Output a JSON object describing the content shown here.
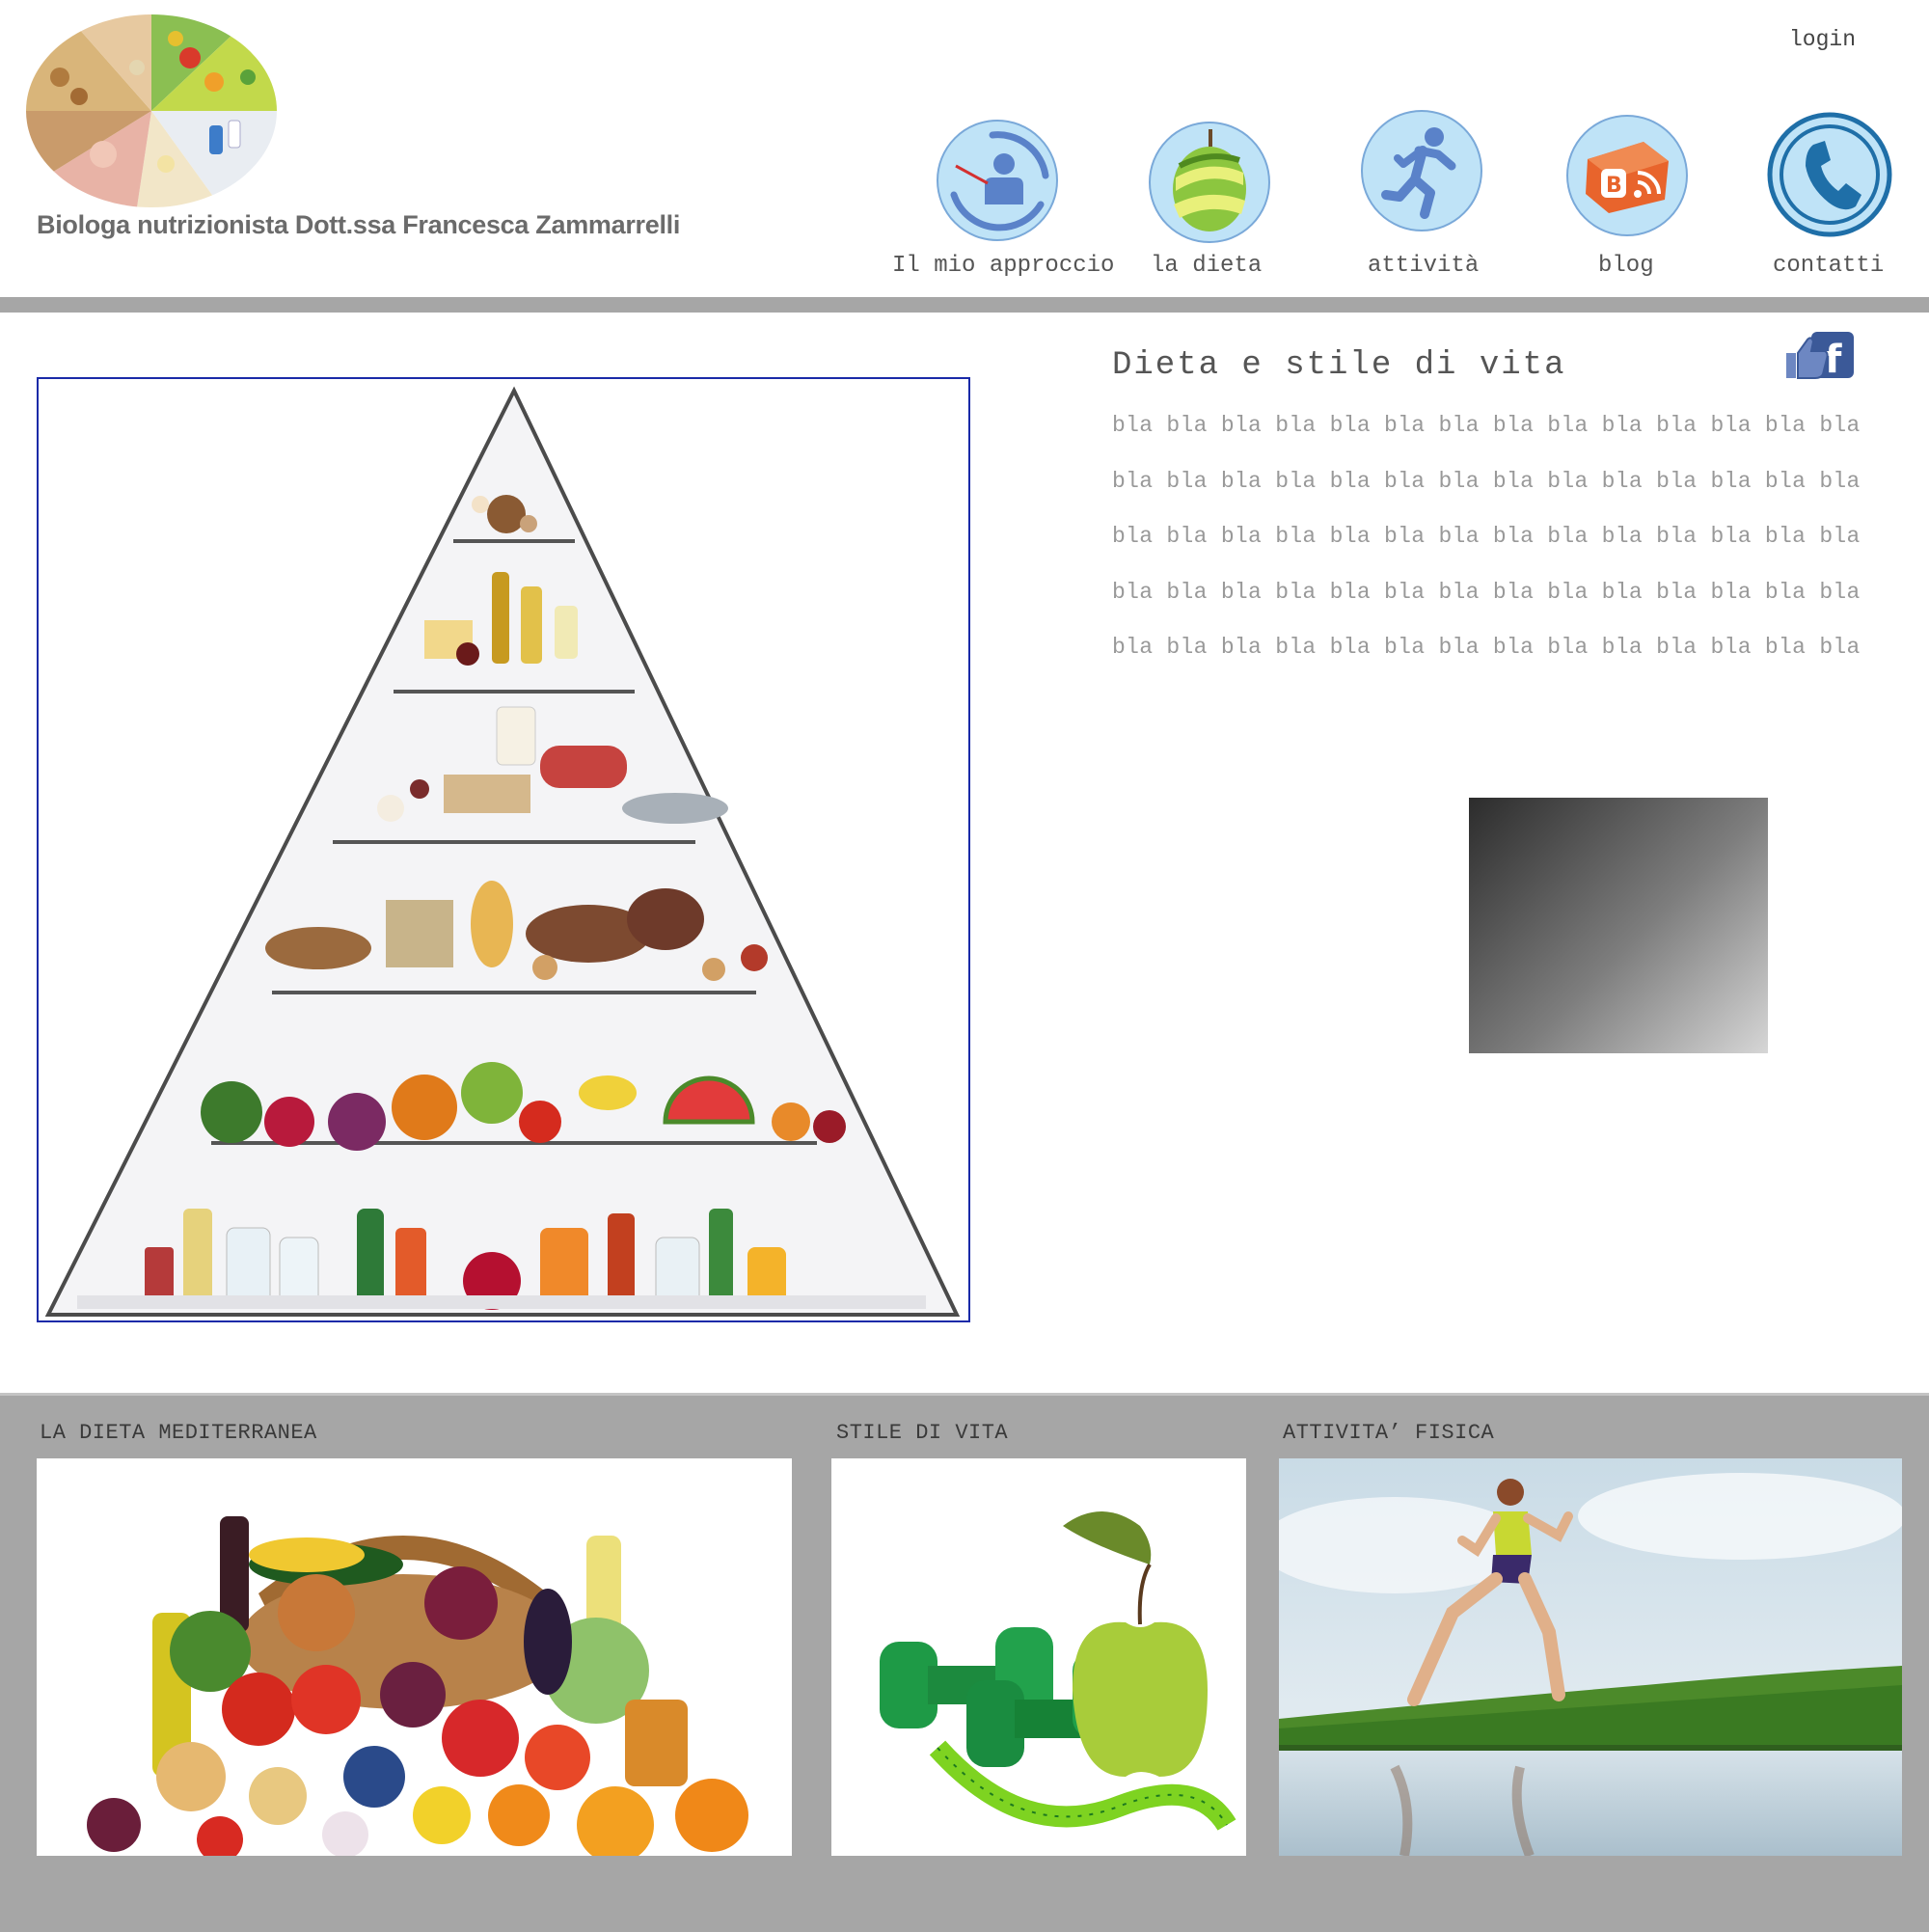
{
  "header": {
    "brand": "Biologa nutrizionista Dott.ssa Francesca Zammarrelli",
    "login": "login",
    "nav": [
      {
        "label": "Il mio approccio",
        "icon": "presenter-icon"
      },
      {
        "label": "la dieta",
        "icon": "apple-peel-icon"
      },
      {
        "label": "attività",
        "icon": "runner-icon"
      },
      {
        "label": "blog",
        "icon": "blogger-icon"
      },
      {
        "label": "contatti",
        "icon": "phone-icon"
      }
    ]
  },
  "main": {
    "title": "Dieta e stile di vita",
    "paragraph_lines": [
      "bla bla bla bla bla bla bla bla bla bla bla bla bla bla",
      "bla bla bla bla bla bla bla bla bla bla bla bla bla bla",
      "bla bla bla bla bla bla bla bla bla bla bla bla bla bla",
      "bla bla bla bla bla bla bla bla bla bla bla bla bla bla",
      "bla bla bla bla bla bla bla bla bla bla bla bla bla bla"
    ],
    "facebook_icon": "facebook-like-icon"
  },
  "footer": {
    "cards": [
      {
        "title": "LA DIETA MEDITERRANEA"
      },
      {
        "title": "STILE DI VITA"
      },
      {
        "title": "ATTIVITA’ FISICA"
      }
    ]
  },
  "colors": {
    "divider": "#a6a6a6",
    "footer_bg": "#a6a6a6",
    "nav_circle": "#bfe3f7",
    "nav_glyph": "#5a82c9",
    "frame_border": "#1a2aa8"
  }
}
